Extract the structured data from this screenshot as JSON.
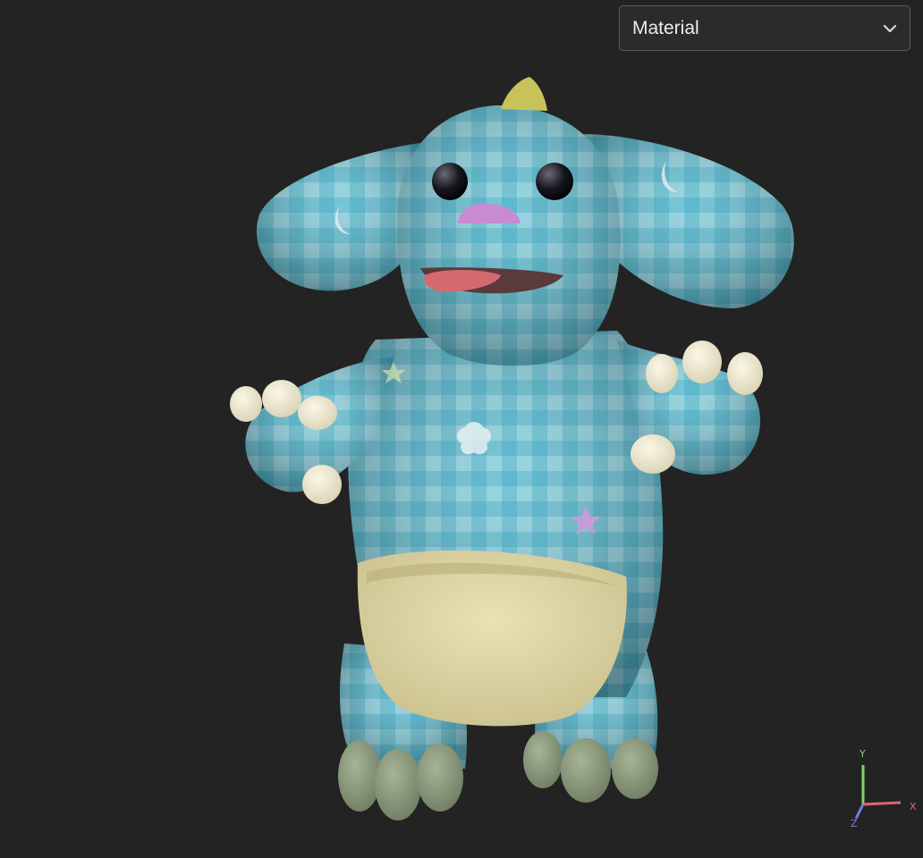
{
  "material_select": {
    "value": "Material",
    "icon": "chevron-down-icon"
  },
  "viewport": {
    "background": "#232323",
    "model": "plush-monster-3d-model"
  },
  "axis_gizmo": {
    "x_label": "X",
    "y_label": "Y",
    "z_label": "Z",
    "x_color": "#d96a6a",
    "y_color": "#7fd46a",
    "z_color": "#7a7ae6"
  }
}
